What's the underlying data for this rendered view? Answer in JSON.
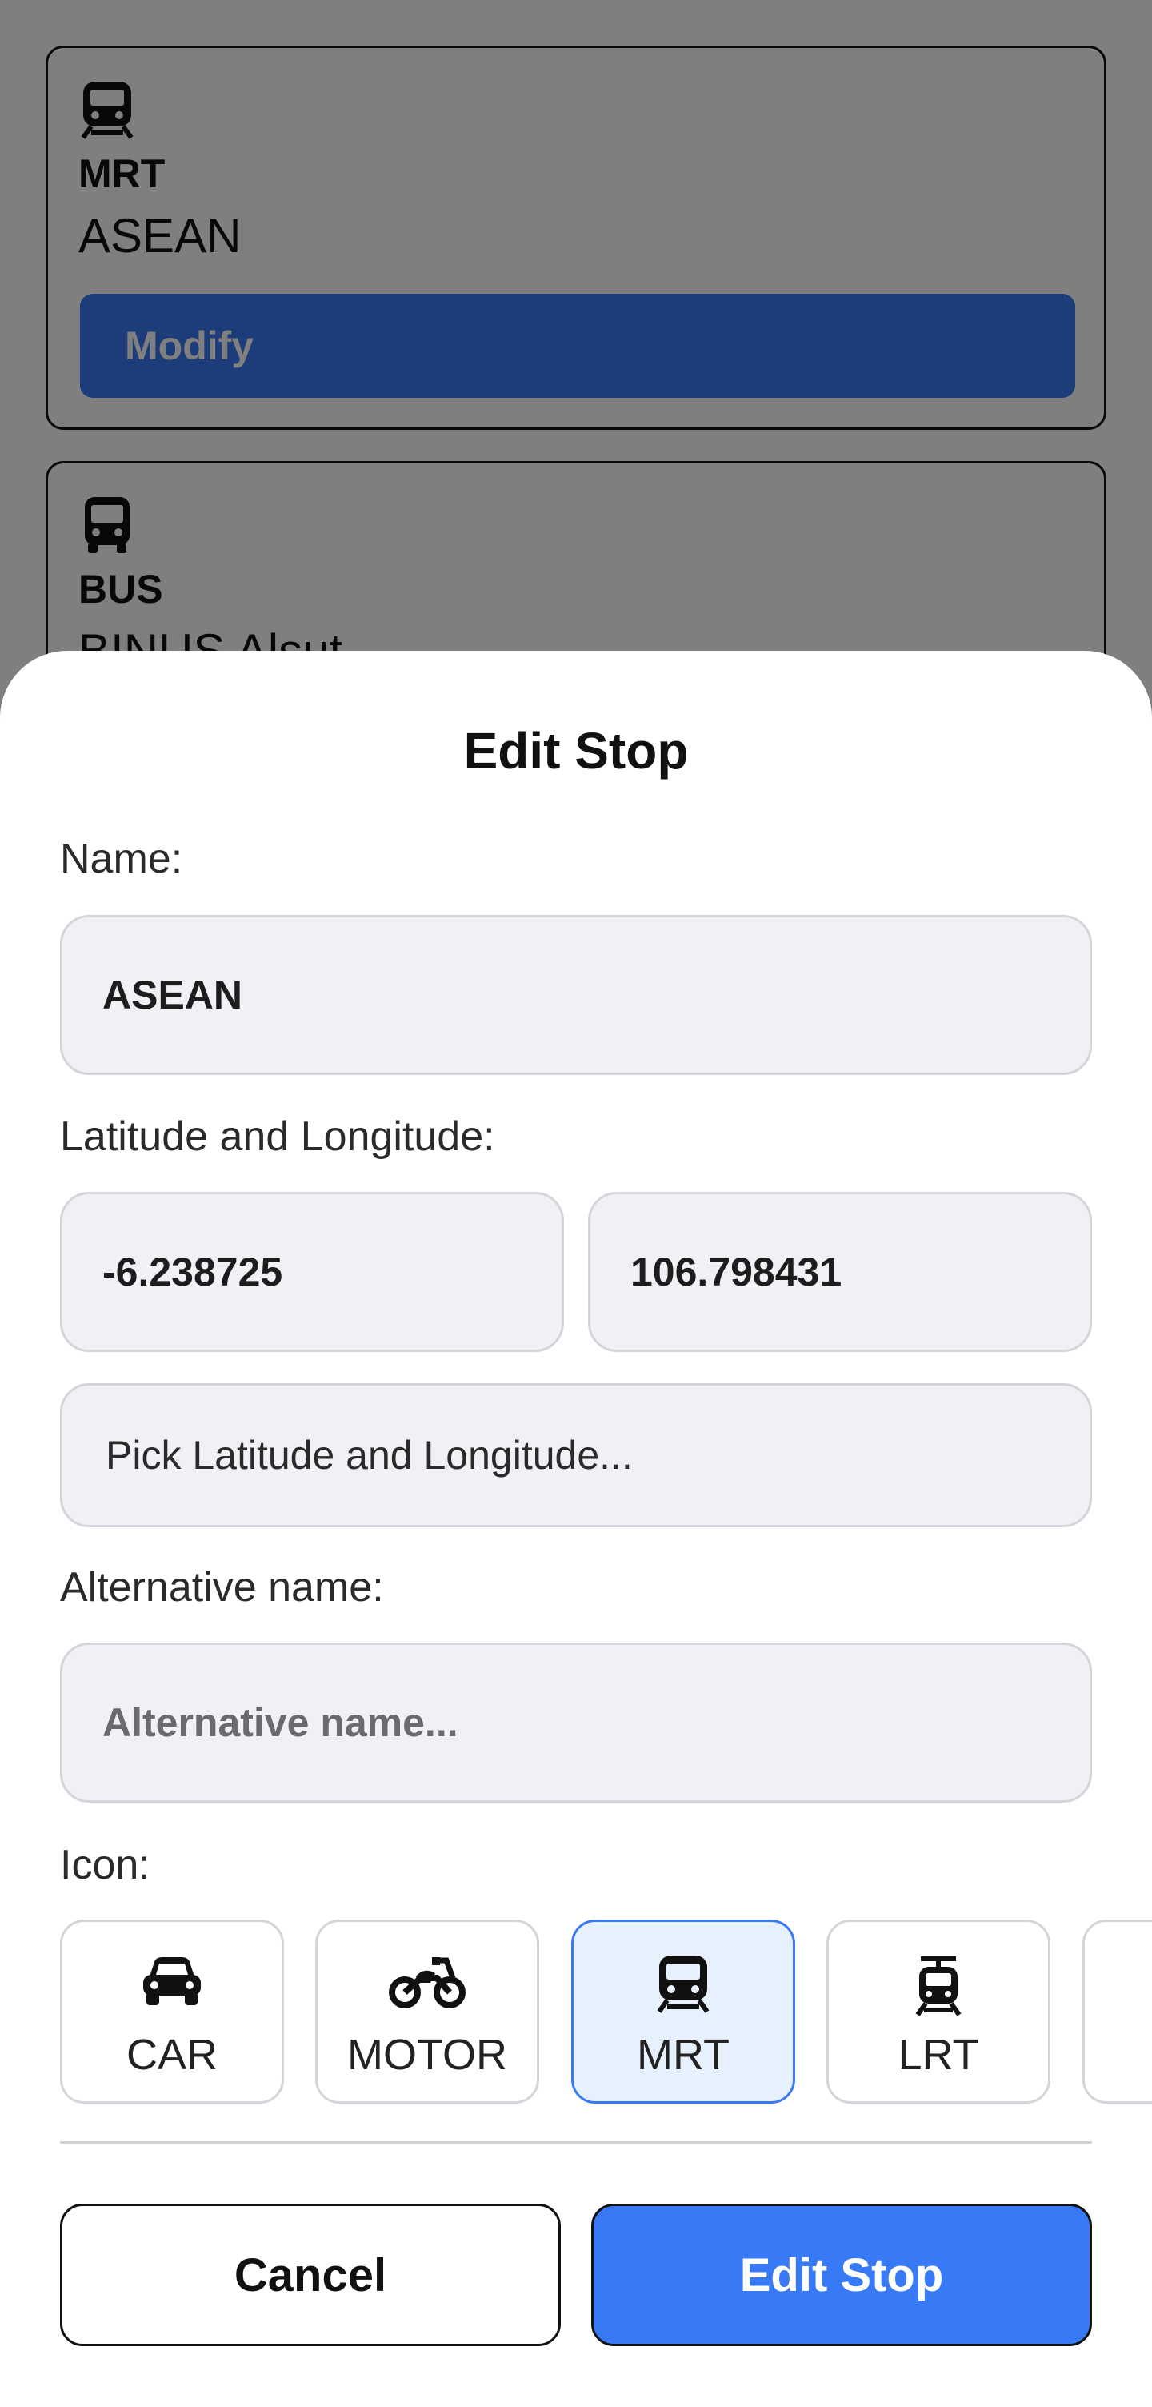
{
  "background": {
    "stops": [
      {
        "type": "MRT",
        "name": "ASEAN",
        "icon": "train-icon",
        "action_label": "Modify"
      },
      {
        "type": "BUS",
        "name": "BINUS Alsut",
        "icon": "bus-icon"
      }
    ]
  },
  "sheet": {
    "title": "Edit Stop",
    "name_label": "Name:",
    "name_value": "ASEAN",
    "latlng_label": "Latitude and Longitude:",
    "latitude_value": "-6.238725",
    "longitude_value": "106.798431",
    "pick_button_label": "Pick Latitude and Longitude...",
    "alt_name_label": "Alternative name:",
    "alt_name_placeholder": "Alternative name...",
    "alt_name_value": "",
    "icon_label": "Icon:",
    "icon_options": [
      {
        "label": "CAR",
        "icon": "car-icon",
        "selected": false
      },
      {
        "label": "MOTOR",
        "icon": "motorcycle-icon",
        "selected": false
      },
      {
        "label": "MRT",
        "icon": "train-icon",
        "selected": true
      },
      {
        "label": "LRT",
        "icon": "tram-icon",
        "selected": false
      }
    ],
    "cancel_label": "Cancel",
    "submit_label": "Edit Stop"
  },
  "colors": {
    "accent": "#3879f5",
    "overlay": "rgba(0,0,0,0.5)",
    "field_bg": "#f0f1f5",
    "selected_bg": "#e7f0fd"
  }
}
